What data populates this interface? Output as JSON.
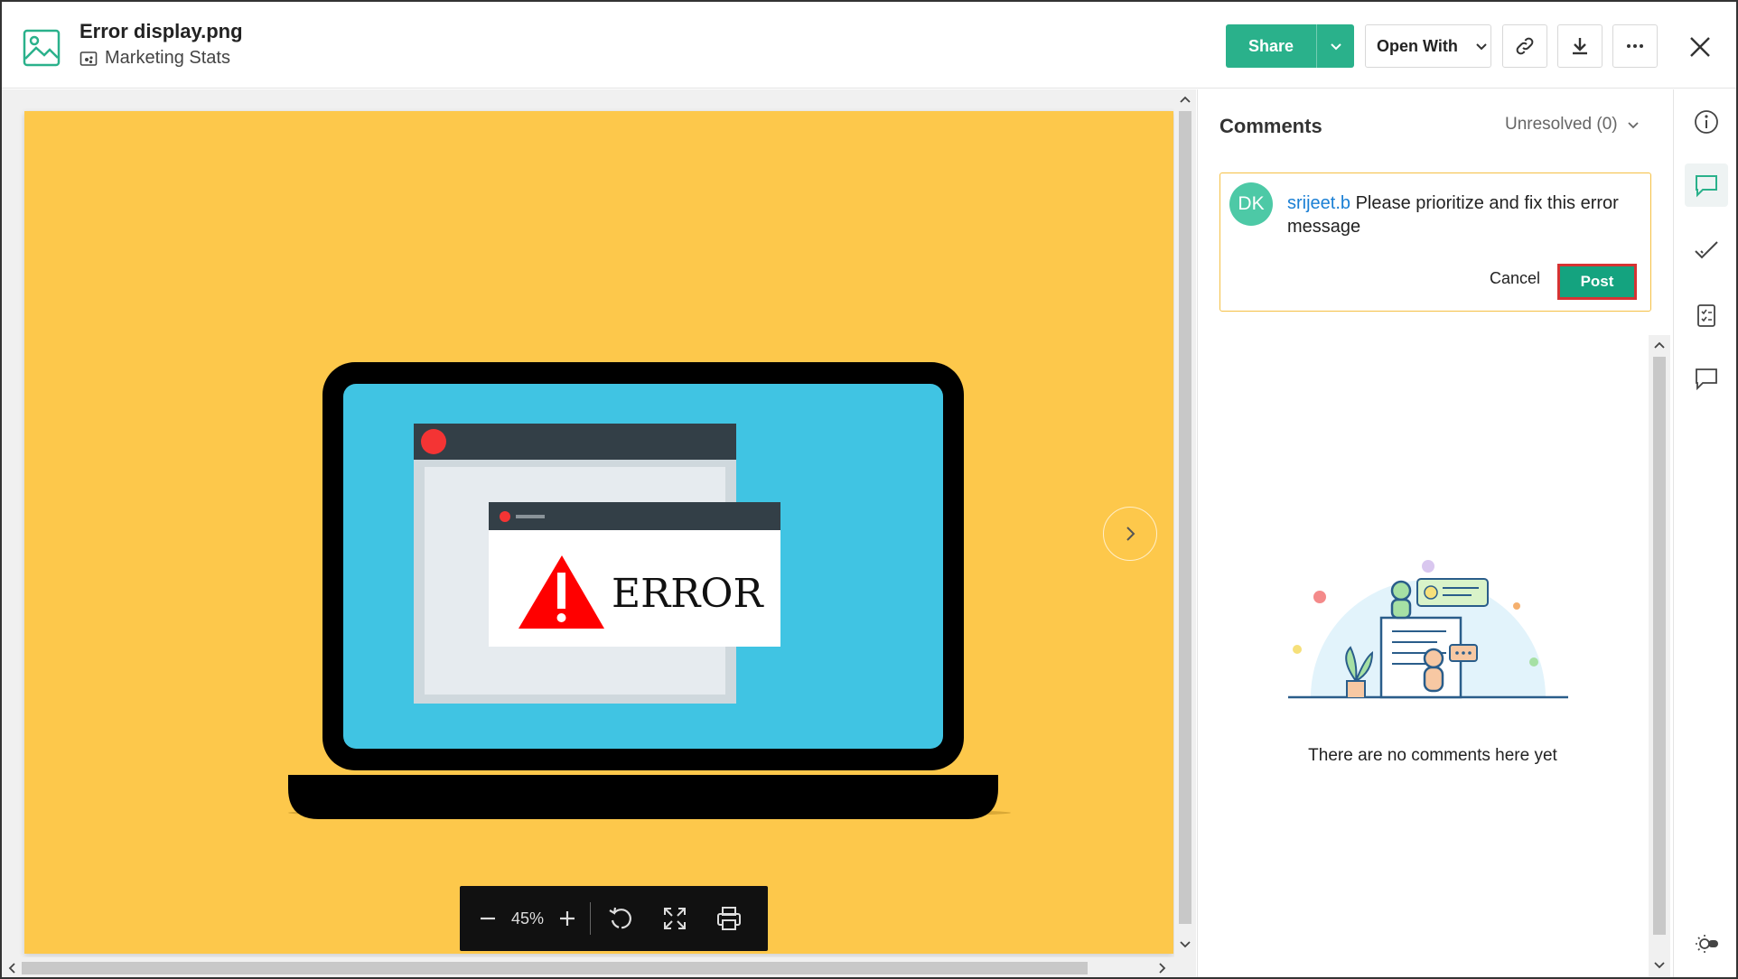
{
  "header": {
    "file_name": "Error display.png",
    "folder_name": "Marketing Stats",
    "share_label": "Share",
    "open_with_label": "Open With"
  },
  "viewer": {
    "zoom": "45%",
    "image_text": "ERROR"
  },
  "comments": {
    "title": "Comments",
    "filter": "Unresolved (0)",
    "draft": {
      "avatar_initials": "DK",
      "mention": "srijeet.b",
      "text": " Please prioritize and fix this error message"
    },
    "cancel_label": "Cancel",
    "post_label": "Post",
    "empty_text": "There are no comments here yet"
  },
  "colors": {
    "accent": "#2ab18b",
    "image_background": "#fdc84b",
    "screen_blue": "#40c4e3",
    "error_red": "#ff0000",
    "mention_blue": "#1a7fd4"
  },
  "icons": [
    "image-file-icon",
    "folder-icon",
    "chevron-down-icon",
    "link-icon",
    "download-icon",
    "more-icon",
    "close-icon",
    "next-icon",
    "zoom-out-icon",
    "zoom-in-icon",
    "rotate-icon",
    "fullscreen-icon",
    "print-icon",
    "info-icon",
    "comment-icon",
    "check-icon",
    "tasks-icon",
    "chat-icon",
    "theme-toggle-icon"
  ]
}
